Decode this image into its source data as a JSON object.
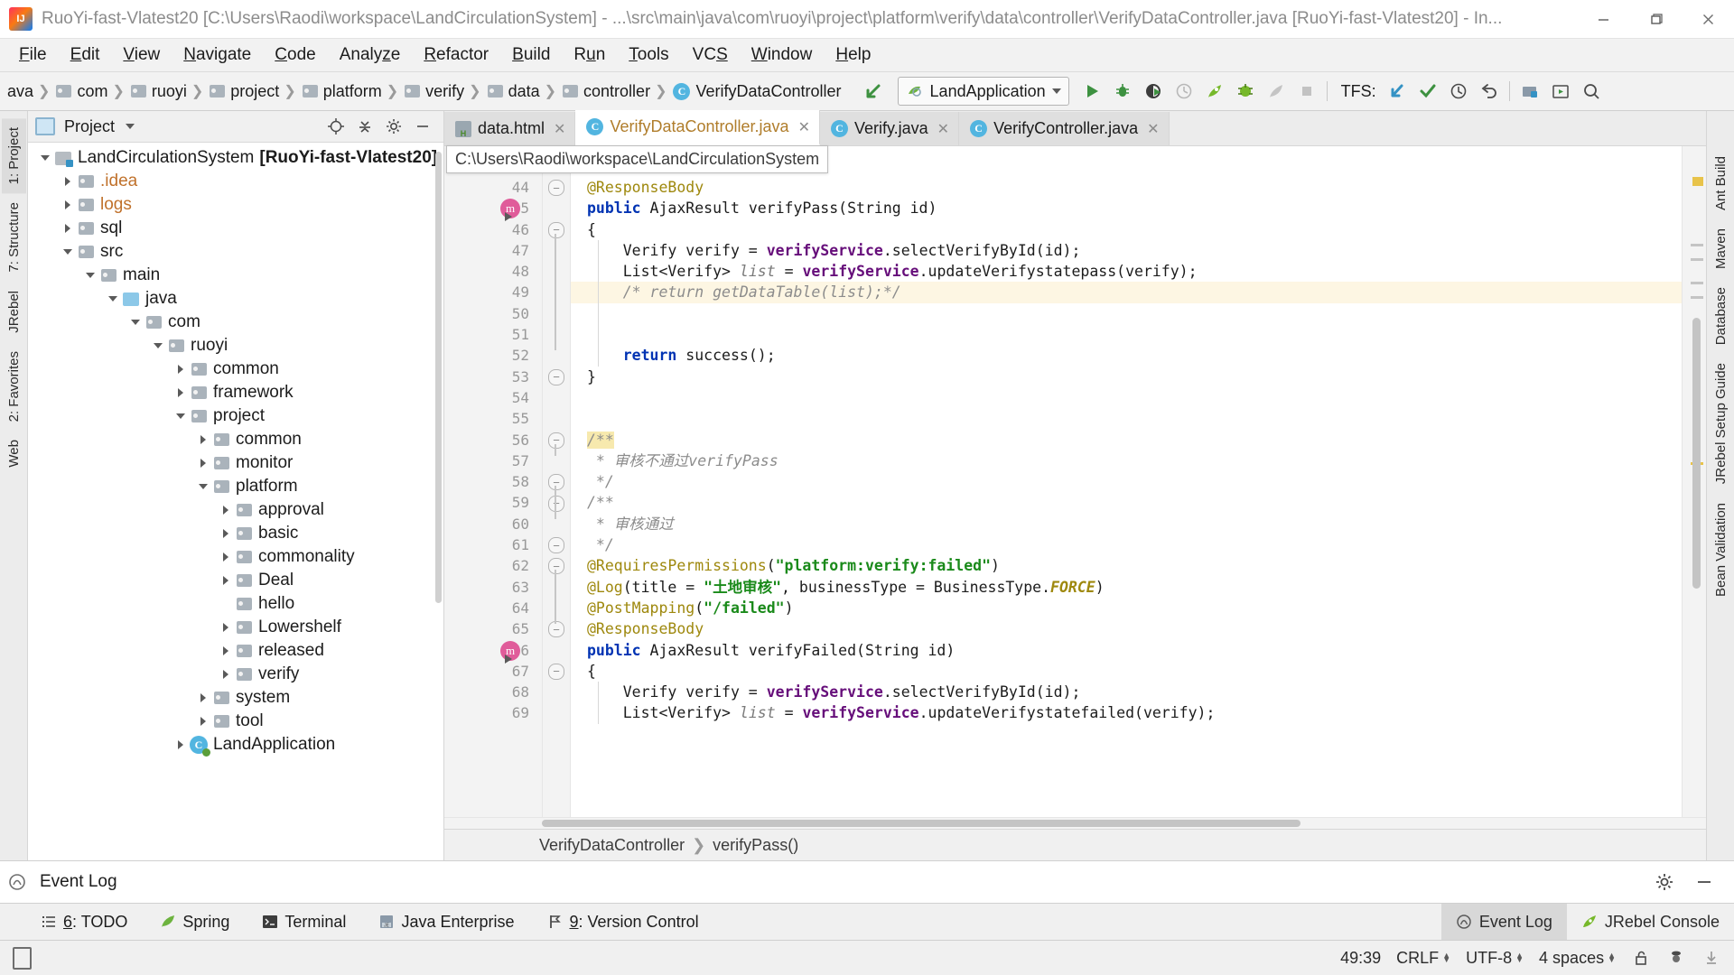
{
  "window": {
    "title": "RuoYi-fast-Vlatest20 [C:\\Users\\Raodi\\workspace\\LandCirculationSystem] - ...\\src\\main\\java\\com\\ruoyi\\project\\platform\\verify\\data\\controller\\VerifyDataController.java [RuoYi-fast-Vlatest20] - In...",
    "minimize": "—",
    "maximize": "❐",
    "close": "✕",
    "logo_text": "IJ"
  },
  "menubar": [
    {
      "label": "File",
      "mnemonic": "F"
    },
    {
      "label": "Edit",
      "mnemonic": "E"
    },
    {
      "label": "View",
      "mnemonic": "V"
    },
    {
      "label": "Navigate",
      "mnemonic": "N"
    },
    {
      "label": "Code",
      "mnemonic": "C"
    },
    {
      "label": "Analyze",
      "mnemonic": "z"
    },
    {
      "label": "Refactor",
      "mnemonic": "R"
    },
    {
      "label": "Build",
      "mnemonic": "B"
    },
    {
      "label": "Run",
      "mnemonic": "u"
    },
    {
      "label": "Tools",
      "mnemonic": "T"
    },
    {
      "label": "VCS",
      "mnemonic": "S"
    },
    {
      "label": "Window",
      "mnemonic": "W"
    },
    {
      "label": "Help",
      "mnemonic": "H"
    }
  ],
  "navbar": {
    "crumbs": [
      {
        "label": "ava",
        "icon": "folder-icon"
      },
      {
        "label": "com",
        "icon": "folder-icon"
      },
      {
        "label": "ruoyi",
        "icon": "folder-icon"
      },
      {
        "label": "project",
        "icon": "folder-icon"
      },
      {
        "label": "platform",
        "icon": "folder-icon"
      },
      {
        "label": "verify",
        "icon": "folder-icon"
      },
      {
        "label": "data",
        "icon": "folder-icon"
      },
      {
        "label": "controller",
        "icon": "folder-icon"
      },
      {
        "label": "VerifyDataController",
        "icon": "java-class-icon"
      }
    ],
    "run_config": "LandApplication",
    "tfs_label": "TFS:",
    "icons": [
      "run-icon",
      "debug-icon",
      "run-with-coverage-icon",
      "profile-icon",
      "jrebel-run-icon",
      "jrebel-debug-icon",
      "jrebel-disabled-icon",
      "stop-icon"
    ],
    "tfs_icons": [
      "check-out-icon",
      "check-in-icon",
      "history-icon",
      "undo-icon"
    ],
    "right_icons": [
      "project-structure-icon",
      "update-icon",
      "search-everywhere-icon"
    ]
  },
  "left_strip": [
    {
      "label": "1: Project",
      "selected": true
    },
    {
      "label": "7: Structure",
      "selected": false
    },
    {
      "label": "JRebel",
      "selected": false
    },
    {
      "label": "2: Favorites",
      "selected": false
    },
    {
      "label": "Web",
      "selected": false
    }
  ],
  "right_strip": [
    {
      "label": "Ant Build"
    },
    {
      "label": "Maven"
    },
    {
      "label": "Database"
    },
    {
      "label": "JRebel Setup Guide"
    },
    {
      "label": "Bean Validation"
    }
  ],
  "project_panel": {
    "title": "Project",
    "header_icons": [
      "locate-icon",
      "collapse-all-icon",
      "settings-icon",
      "hide-icon"
    ],
    "tree": [
      {
        "depth": 0,
        "arrow": "down",
        "icon": "module-icon",
        "label": "LandCirculationSystem",
        "suffix": "[RuoYi-fast-Vlatest20]",
        "bold": true
      },
      {
        "depth": 1,
        "arrow": "right",
        "icon": "folder-icon",
        "label": ".idea",
        "color": "orange"
      },
      {
        "depth": 1,
        "arrow": "right",
        "icon": "folder-icon",
        "label": "logs",
        "color": "orange"
      },
      {
        "depth": 1,
        "arrow": "right",
        "icon": "folder-icon",
        "label": "sql"
      },
      {
        "depth": 1,
        "arrow": "down",
        "icon": "folder-icon",
        "label": "src"
      },
      {
        "depth": 2,
        "arrow": "down",
        "icon": "folder-icon",
        "label": "main"
      },
      {
        "depth": 3,
        "arrow": "down",
        "icon": "source-root-icon",
        "label": "java"
      },
      {
        "depth": 4,
        "arrow": "down",
        "icon": "package-icon",
        "label": "com"
      },
      {
        "depth": 5,
        "arrow": "down",
        "icon": "package-icon",
        "label": "ruoyi"
      },
      {
        "depth": 6,
        "arrow": "right",
        "icon": "package-icon",
        "label": "common"
      },
      {
        "depth": 6,
        "arrow": "right",
        "icon": "package-icon",
        "label": "framework"
      },
      {
        "depth": 6,
        "arrow": "down",
        "icon": "package-icon",
        "label": "project"
      },
      {
        "depth": 7,
        "arrow": "right",
        "icon": "package-icon",
        "label": "common"
      },
      {
        "depth": 7,
        "arrow": "right",
        "icon": "package-icon",
        "label": "monitor"
      },
      {
        "depth": 7,
        "arrow": "down",
        "icon": "package-icon",
        "label": "platform"
      },
      {
        "depth": 8,
        "arrow": "right",
        "icon": "package-icon",
        "label": "approval"
      },
      {
        "depth": 8,
        "arrow": "right",
        "icon": "package-icon",
        "label": "basic"
      },
      {
        "depth": 8,
        "arrow": "right",
        "icon": "package-icon",
        "label": "commonality"
      },
      {
        "depth": 8,
        "arrow": "right",
        "icon": "package-icon",
        "label": "Deal"
      },
      {
        "depth": 8,
        "arrow": "none",
        "icon": "package-icon",
        "label": "hello"
      },
      {
        "depth": 8,
        "arrow": "right",
        "icon": "package-icon",
        "label": "Lowershelf"
      },
      {
        "depth": 8,
        "arrow": "right",
        "icon": "package-icon",
        "label": "released"
      },
      {
        "depth": 8,
        "arrow": "right",
        "icon": "package-icon",
        "label": "verify"
      },
      {
        "depth": 7,
        "arrow": "right",
        "icon": "package-icon",
        "label": "system"
      },
      {
        "depth": 7,
        "arrow": "right",
        "icon": "package-icon",
        "label": "tool"
      },
      {
        "depth": 6,
        "arrow": "right",
        "icon": "java-class-icon",
        "label": "LandApplication"
      }
    ]
  },
  "editor": {
    "tabs": [
      {
        "label": "data.html",
        "icon": "html-file-icon",
        "active": false
      },
      {
        "label": "VerifyDataController.java",
        "icon": "java-class-icon",
        "active": true
      },
      {
        "label": "Verify.java",
        "icon": "java-class-icon",
        "active": false
      },
      {
        "label": "VerifyController.java",
        "icon": "java-class-icon",
        "active": false
      }
    ],
    "tooltip": "C:\\Users\\Raodi\\workspace\\LandCirculationSystem",
    "overlay_text": ")",
    "breadcrumb": [
      "VerifyDataController",
      "verifyPass()"
    ],
    "first_line_number": 44,
    "lines": [
      {
        "n": 44,
        "fold": "end",
        "text": "@ResponseBody",
        "kind": "annotation"
      },
      {
        "n": 45,
        "marker": "method-override",
        "text": "public AjaxResult verifyPass(String id)",
        "kind": "signature"
      },
      {
        "n": 46,
        "fold": "start",
        "text": "{",
        "kind": "plain"
      },
      {
        "n": 47,
        "text": "    Verify verify = verifyService.selectVerifyById(id);",
        "kind": "stmt"
      },
      {
        "n": 48,
        "text": "    List<Verify> list = verifyService.updateVerifystatepass(verify);",
        "kind": "stmt"
      },
      {
        "n": 49,
        "text": "    /* return getDataTable(list);*/",
        "kind": "comment",
        "highlight": true
      },
      {
        "n": 50,
        "text": "",
        "kind": "plain"
      },
      {
        "n": 51,
        "text": "",
        "kind": "plain"
      },
      {
        "n": 52,
        "text": "    return success();",
        "kind": "return"
      },
      {
        "n": 53,
        "fold": "end",
        "text": "}",
        "kind": "plain"
      },
      {
        "n": 54,
        "text": "",
        "kind": "plain"
      },
      {
        "n": 55,
        "text": "",
        "kind": "plain"
      },
      {
        "n": 56,
        "fold": "start",
        "text": "/**",
        "kind": "comment",
        "chip": true
      },
      {
        "n": 57,
        "text": " * 审核不通过verifyPass",
        "kind": "comment"
      },
      {
        "n": 58,
        "fold": "end",
        "text": " */",
        "kind": "comment"
      },
      {
        "n": 59,
        "fold": "start",
        "text": "/**",
        "kind": "comment"
      },
      {
        "n": 60,
        "text": " * 审核通过",
        "kind": "comment"
      },
      {
        "n": 61,
        "fold": "end",
        "text": " */",
        "kind": "comment"
      },
      {
        "n": 62,
        "fold": "start",
        "text": "@RequiresPermissions(\"platform:verify:failed\")",
        "kind": "annotation-str"
      },
      {
        "n": 63,
        "text": "@Log(title = \"土地审核\", businessType = BusinessType.FORCE)",
        "kind": "annotation-log"
      },
      {
        "n": 64,
        "text": "@PostMapping(\"/failed\")",
        "kind": "annotation-str"
      },
      {
        "n": 65,
        "fold": "end",
        "text": "@ResponseBody",
        "kind": "annotation"
      },
      {
        "n": 66,
        "marker": "method-override",
        "text": "public AjaxResult verifyFailed(String id)",
        "kind": "signature"
      },
      {
        "n": 67,
        "fold": "start",
        "text": "{",
        "kind": "plain"
      },
      {
        "n": 68,
        "text": "    Verify verify = verifyService.selectVerifyById(id);",
        "kind": "stmt"
      },
      {
        "n": 69,
        "text": "    List<Verify> list = verifyService.updateVerifystatefailed(verify);",
        "kind": "stmt"
      }
    ]
  },
  "event_log": {
    "title": "Event Log",
    "settings_icon": "gear-icon",
    "hide_icon": "hide-icon"
  },
  "bottom_bar": {
    "left": [
      {
        "label": "6: TODO",
        "mnemonic": "6",
        "icon": "todo-icon"
      },
      {
        "label": "Spring",
        "icon": "spring-icon"
      },
      {
        "label": "Terminal",
        "icon": "terminal-icon"
      },
      {
        "label": "Java Enterprise",
        "icon": "java-enterprise-icon"
      },
      {
        "label": "9: Version Control",
        "mnemonic": "9",
        "icon": "version-control-icon"
      }
    ],
    "right": [
      {
        "label": "Event Log",
        "icon": "event-log-icon",
        "selected": true
      },
      {
        "label": "JRebel Console",
        "icon": "jrebel-icon",
        "selected": false
      }
    ]
  },
  "status_bar": {
    "caret": "49:39",
    "line_separator": "CRLF",
    "encoding": "UTF-8",
    "indent": "4 spaces",
    "icons": [
      "lock-open-icon",
      "hector-icon",
      "download-icon"
    ]
  },
  "colors": {
    "accent_orange": "#b07d2b",
    "keyword_blue": "#0033b3",
    "string_green": "#1a8a1a",
    "annotation_yellow": "#9e880d",
    "field_purple": "#660e7a",
    "comment_gray": "#8c8c8c",
    "highlight_yellow": "#fdf6e3"
  }
}
